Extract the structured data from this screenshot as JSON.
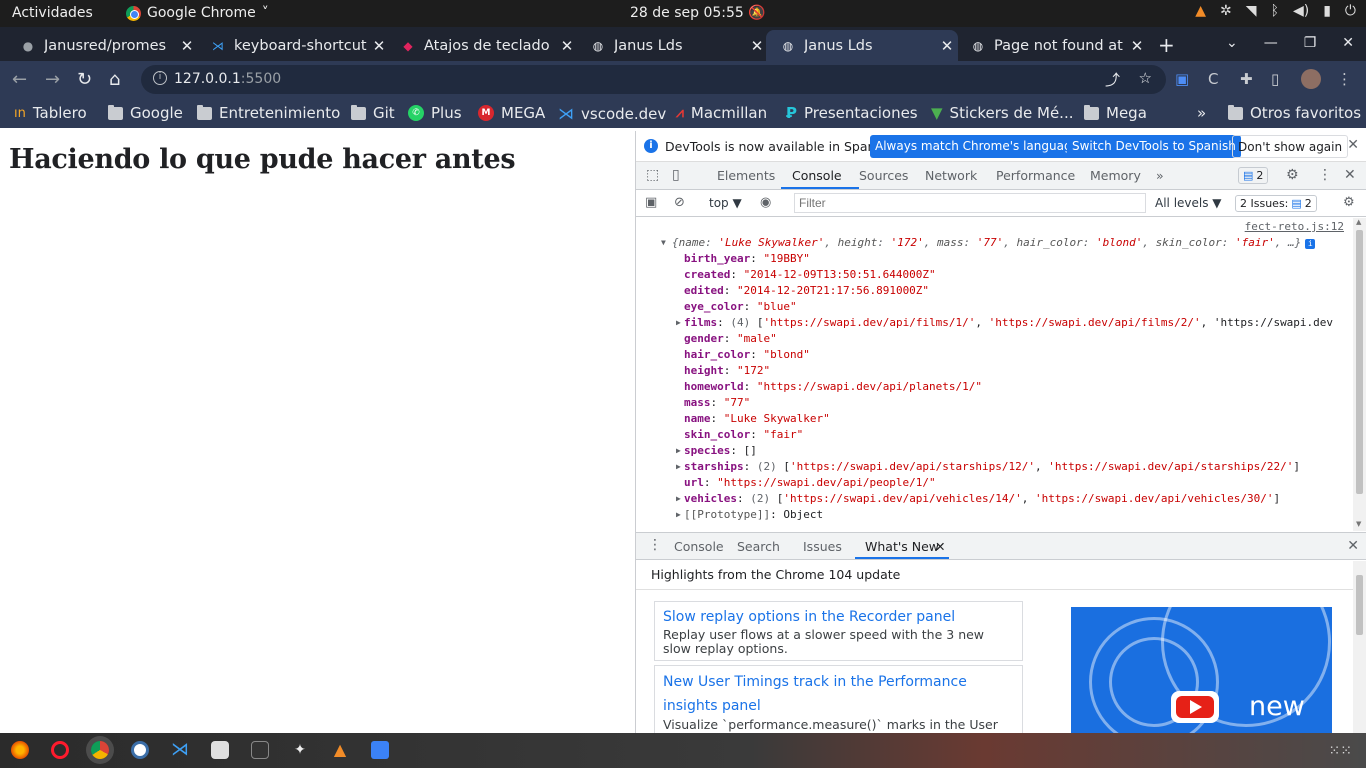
{
  "topbar": {
    "activities": "Actividades",
    "app_name": "Google Chrome",
    "app_caret": "˅",
    "clock": "28 de sep  05:55",
    "tray_icons": [
      "vlc-icon",
      "network-share-icon",
      "wifi-icon",
      "bluetooth-icon",
      "volume-icon",
      "battery-icon",
      "power-icon"
    ]
  },
  "tabs": [
    {
      "title": "Janusred/promes",
      "favicon": "github-icon",
      "active": false
    },
    {
      "title": "keyboard-shortcut",
      "favicon": "vscode-icon",
      "active": false
    },
    {
      "title": "Atajos de teclado",
      "favicon": "site-icon",
      "active": false
    },
    {
      "title": "Janus Lds",
      "favicon": "globe-icon",
      "active": false
    },
    {
      "title": "Janus Lds",
      "favicon": "globe-icon",
      "active": true
    },
    {
      "title": "Page not found at",
      "favicon": "globe-icon",
      "active": false
    }
  ],
  "toolbar": {
    "url_host": "127.0.0.1",
    "url_port": ":5500"
  },
  "bookmarks": [
    {
      "label": "Tablero",
      "icon": "tablero-icon"
    },
    {
      "label": "Google",
      "icon": "folder-icon"
    },
    {
      "label": "Entretenimiento",
      "icon": "folder-icon"
    },
    {
      "label": "Git",
      "icon": "folder-icon"
    },
    {
      "label": "Plus",
      "icon": "whatsapp-icon"
    },
    {
      "label": "MEGA",
      "icon": "mega-icon"
    },
    {
      "label": "vscode.dev",
      "icon": "vscode-icon"
    },
    {
      "label": "Macmillan",
      "icon": "macmillan-icon"
    },
    {
      "label": "Presentaciones",
      "icon": "presentaciones-icon"
    },
    {
      "label": "Stickers de Mé...",
      "icon": "stickers-icon"
    },
    {
      "label": "Mega",
      "icon": "folder-icon"
    }
  ],
  "bookmarks_more": "»",
  "other_bookmarks": "Otros favoritos",
  "page": {
    "heading": "Haciendo lo que pude hacer antes"
  },
  "devtools": {
    "infobar": {
      "message": "DevTools is now available in Spanish!",
      "btn_match": "Always match Chrome's language",
      "btn_switch": "Switch DevTools to Spanish",
      "btn_dont": "Don't show again"
    },
    "tabs": [
      "Elements",
      "Console",
      "Sources",
      "Network",
      "Performance",
      "Memory"
    ],
    "more": "»",
    "msg_count": "2",
    "console_toolbar": {
      "context": "top ▼",
      "filter_placeholder": "Filter",
      "levels": "All levels ▼",
      "issues_label": "2 Issues:",
      "issues_count": "2"
    },
    "source_link": "fect-reto.js:12",
    "summary": {
      "open": "{",
      "pairs": [
        {
          "k": "name",
          "v": "'Luke Skywalker'"
        },
        {
          "k": "height",
          "v": "'172'"
        },
        {
          "k": "mass",
          "v": "'77'"
        },
        {
          "k": "hair_color",
          "v": "'blond'"
        },
        {
          "k": "skin_color",
          "v": "'fair'"
        }
      ],
      "tail": ", …}"
    },
    "props": [
      {
        "key": "birth_year",
        "val": "\"19BBY\"",
        "kind": "s"
      },
      {
        "key": "created",
        "val": "\"2014-12-09T13:50:51.644000Z\"",
        "kind": "s"
      },
      {
        "key": "edited",
        "val": "\"2014-12-20T21:17:56.891000Z\"",
        "kind": "s"
      },
      {
        "key": "eye_color",
        "val": "\"blue\"",
        "kind": "s"
      },
      {
        "key": "films",
        "count": "(4)",
        "val": "['https://swapi.dev/api/films/1/', 'https://swapi.dev/api/films/2/', 'https://swapi.dev",
        "kind": "arr"
      },
      {
        "key": "gender",
        "val": "\"male\"",
        "kind": "s"
      },
      {
        "key": "hair_color",
        "val": "\"blond\"",
        "kind": "s"
      },
      {
        "key": "height",
        "val": "\"172\"",
        "kind": "s"
      },
      {
        "key": "homeworld",
        "val": "\"https://swapi.dev/api/planets/1/\"",
        "kind": "s"
      },
      {
        "key": "mass",
        "val": "\"77\"",
        "kind": "s"
      },
      {
        "key": "name",
        "val": "\"Luke Skywalker\"",
        "kind": "s"
      },
      {
        "key": "skin_color",
        "val": "\"fair\"",
        "kind": "s"
      },
      {
        "key": "species",
        "val": "[]",
        "kind": "empty"
      },
      {
        "key": "starships",
        "count": "(2)",
        "val": "['https://swapi.dev/api/starships/12/', 'https://swapi.dev/api/starships/22/']",
        "kind": "arr"
      },
      {
        "key": "url",
        "val": "\"https://swapi.dev/api/people/1/\"",
        "kind": "s"
      },
      {
        "key": "vehicles",
        "count": "(2)",
        "val": "['https://swapi.dev/api/vehicles/14/', 'https://swapi.dev/api/vehicles/30/']",
        "kind": "arr"
      },
      {
        "key": "[[Prototype]]",
        "val": "Object",
        "kind": "proto"
      }
    ],
    "drawer": {
      "tabs": [
        "Console",
        "Search",
        "Issues",
        "What's New"
      ],
      "highlights": "Highlights from the Chrome 104 update",
      "cards": [
        {
          "title": "Slow replay options in the Recorder panel",
          "desc": "Replay user flows at a slower speed with the 3 new slow replay options."
        },
        {
          "title": "New User Timings track in the Performance insights panel",
          "desc": "Visualize `performance.measure()` marks in the User Timings track."
        }
      ],
      "promo_text": "new"
    }
  },
  "dock": {
    "apps": [
      "firefox-icon",
      "opera-icon",
      "chrome-icon",
      "brave-icon",
      "vscode-icon",
      "files-icon",
      "terminal-icon",
      "unity-icon",
      "vlc-icon",
      "text-editor-icon"
    ]
  }
}
